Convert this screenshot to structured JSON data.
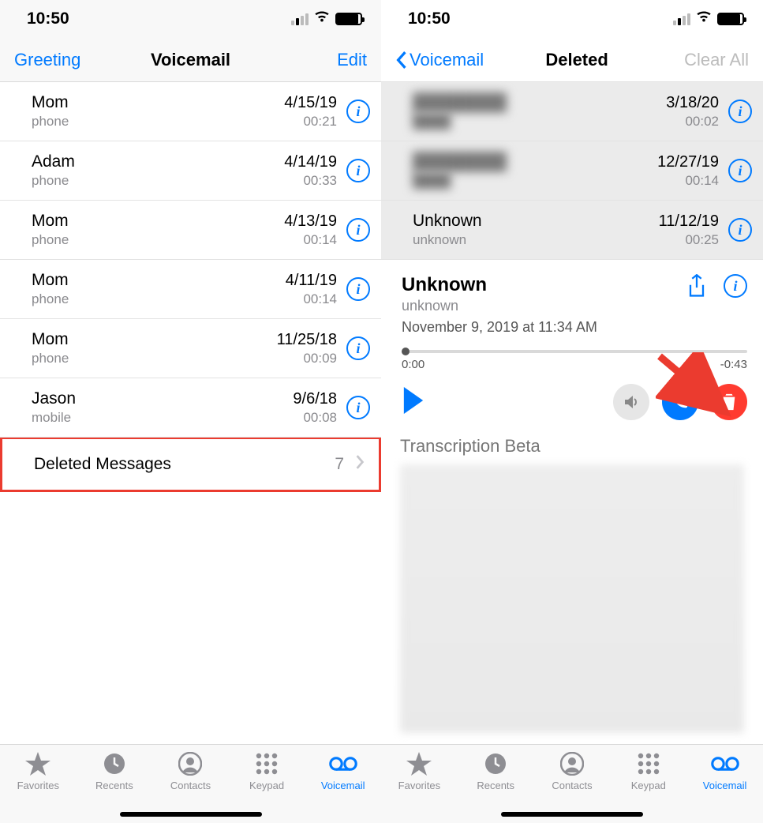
{
  "left": {
    "status": {
      "time": "10:50"
    },
    "nav": {
      "left": "Greeting",
      "title": "Voicemail",
      "right": "Edit"
    },
    "rows": [
      {
        "name": "Mom",
        "sub": "phone",
        "date": "4/15/19",
        "dur": "00:21"
      },
      {
        "name": "Adam",
        "sub": "phone",
        "date": "4/14/19",
        "dur": "00:33"
      },
      {
        "name": "Mom",
        "sub": "phone",
        "date": "4/13/19",
        "dur": "00:14"
      },
      {
        "name": "Mom",
        "sub": "phone",
        "date": "4/11/19",
        "dur": "00:14"
      },
      {
        "name": "Mom",
        "sub": "phone",
        "date": "11/25/18",
        "dur": "00:09"
      },
      {
        "name": "Jason",
        "sub": "mobile",
        "date": "9/6/18",
        "dur": "00:08"
      }
    ],
    "deleted": {
      "label": "Deleted Messages",
      "count": "7"
    }
  },
  "right": {
    "status": {
      "time": "10:50"
    },
    "nav": {
      "back": "Voicemail",
      "title": "Deleted",
      "right": "Clear All"
    },
    "rows": [
      {
        "name": "████████",
        "sub": "████",
        "date": "3/18/20",
        "dur": "00:02",
        "blurred": true
      },
      {
        "name": "████████",
        "sub": "████",
        "date": "12/27/19",
        "dur": "00:14",
        "blurred": true
      },
      {
        "name": "Unknown",
        "sub": "unknown",
        "date": "11/12/19",
        "dur": "00:25",
        "blurred": false
      }
    ],
    "player": {
      "name": "Unknown",
      "sub": "unknown",
      "date": "November 9, 2019 at 11:34 AM",
      "start": "0:00",
      "end": "-0:43",
      "transcription": "Transcription Beta"
    }
  },
  "tabs": [
    {
      "label": "Favorites",
      "icon": "star"
    },
    {
      "label": "Recents",
      "icon": "clock"
    },
    {
      "label": "Contacts",
      "icon": "person"
    },
    {
      "label": "Keypad",
      "icon": "keypad"
    },
    {
      "label": "Voicemail",
      "icon": "voicemail"
    }
  ],
  "accent": "#007aff",
  "highlight": "#eb3b2f"
}
